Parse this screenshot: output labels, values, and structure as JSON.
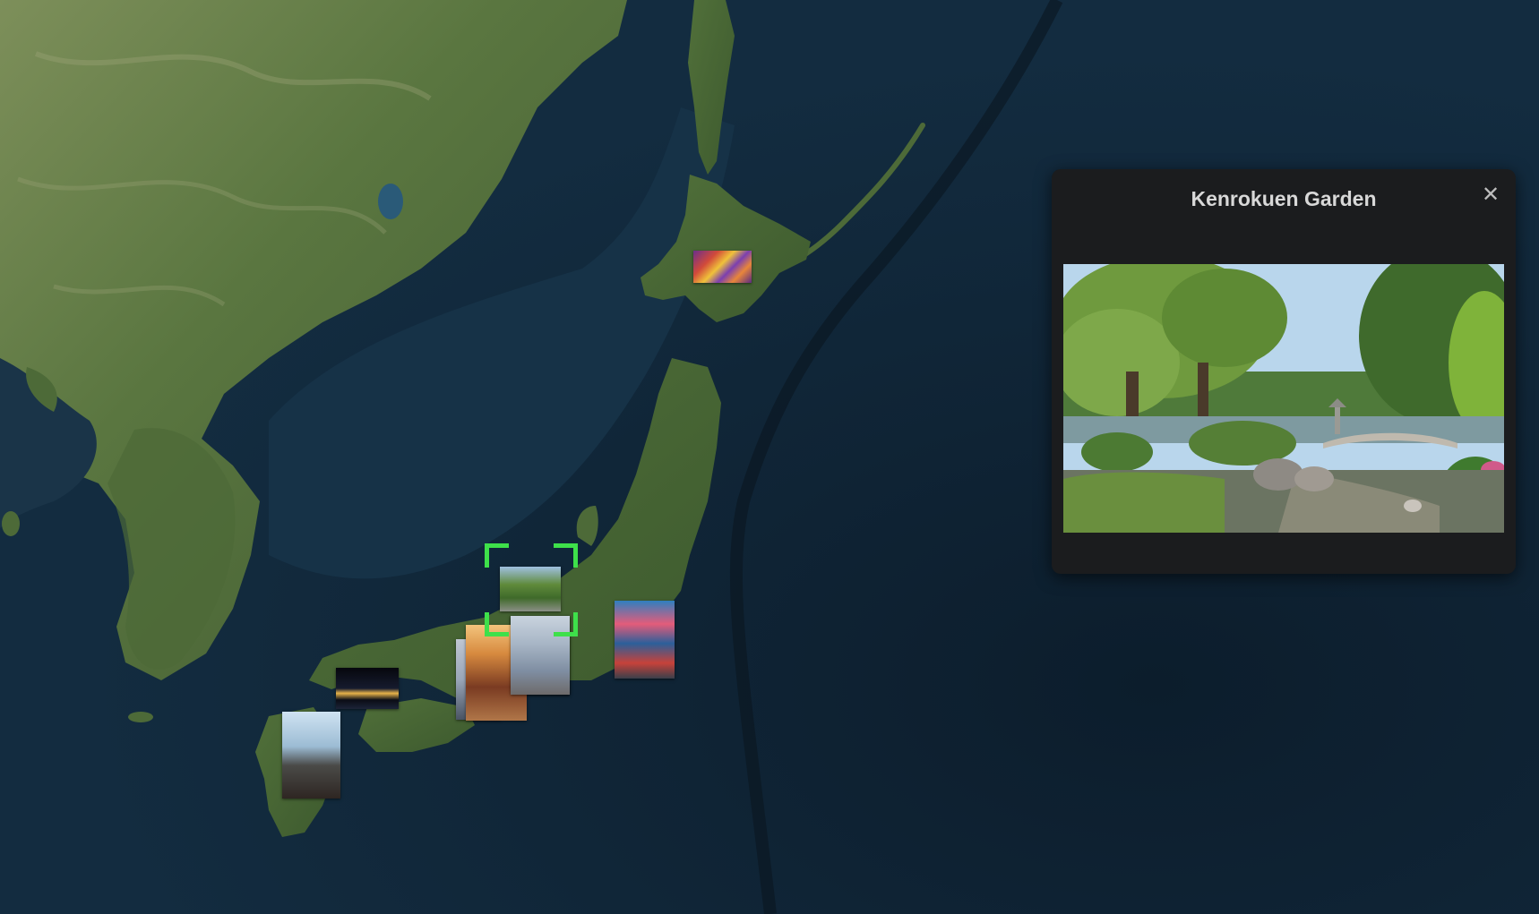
{
  "map": {
    "colors": {
      "ocean": "#0f2436",
      "shelf": "#1c3a50",
      "land_green": "#4e6b3a",
      "land_light": "#8f9a6e",
      "lake": "#2a5a78"
    },
    "markers": [
      {
        "id": "flowers",
        "icon": "flower-field-photo-thumbnail"
      },
      {
        "id": "garden",
        "icon": "garden-photo-thumbnail",
        "selected": true
      },
      {
        "id": "tower",
        "icon": "tower-photo-thumbnail"
      },
      {
        "id": "pagoda",
        "icon": "pagoda-photo-thumbnail"
      },
      {
        "id": "shrine",
        "icon": "shrine-photo-thumbnail"
      },
      {
        "id": "market",
        "icon": "market-street-photo-thumbnail"
      },
      {
        "id": "night",
        "icon": "night-city-photo-thumbnail"
      },
      {
        "id": "volcano",
        "icon": "volcano-photo-thumbnail"
      }
    ]
  },
  "popup": {
    "title": "Kenrokuen Garden",
    "close_icon": "close-icon",
    "photo_icon": "garden-pond-photo"
  },
  "selection": {
    "color": "#3ee04a"
  }
}
